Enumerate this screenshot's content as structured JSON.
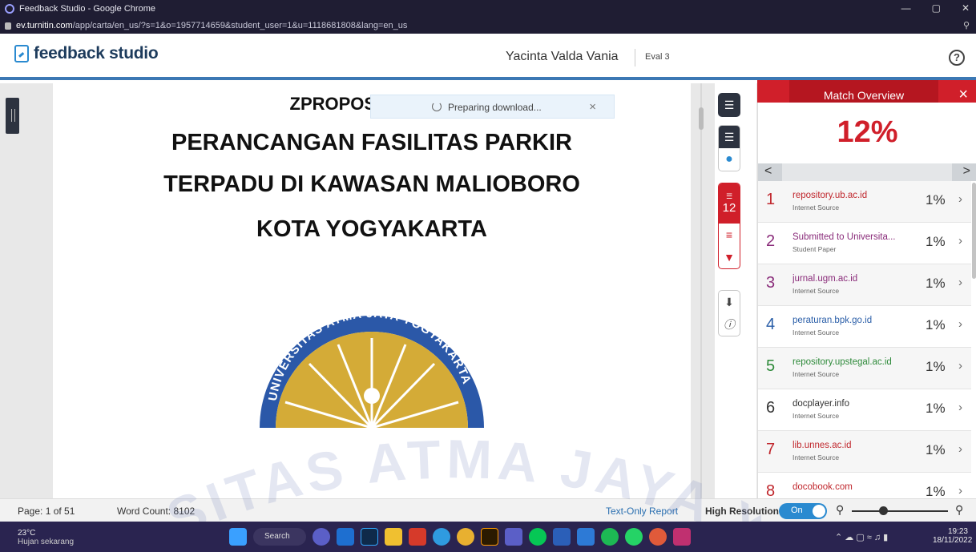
{
  "browser": {
    "window_title": "Feedback Studio - Google Chrome",
    "url_host": "ev.turnitin.com",
    "url_path": "/app/carta/en_us/?s=1&o=1957714659&student_user=1&u=1118681808&lang=en_us"
  },
  "header": {
    "logo_text": "feedback studio",
    "student_name": "Yacinta Valda Vania",
    "assignment": "Eval 3",
    "help_label": "?"
  },
  "toast": {
    "text": "Preparing download...",
    "close": "×"
  },
  "document": {
    "top_line": "ZPROPOSAL TUGA",
    "title_lines": [
      "PERANCANGAN FASILITAS PARKIR",
      "TERPADU DI KAWASAN MALIOBORO",
      "KOTA YOGYAKARTA"
    ],
    "logo_ring_text": "UNIVERSITAS ATMA JAYA YOGYAKARTA",
    "watermark_text": "SITAS ATMA JAYA YOGYA"
  },
  "tools": {
    "match_count": "12",
    "icons": [
      "layers-icon",
      "comment-icon",
      "match-icon",
      "sort-icon",
      "filter-icon",
      "download-icon",
      "info-icon"
    ]
  },
  "panel": {
    "title": "Match Overview",
    "close": "×",
    "similarity": "12%",
    "nav_prev": "<",
    "nav_next": ">",
    "matches": [
      {
        "num": "1",
        "source": "repository.ub.ac.id",
        "type": "Internet Source",
        "pct": "1%",
        "color": "#c0272d"
      },
      {
        "num": "2",
        "source": "Submitted to Universita...",
        "type": "Student Paper",
        "pct": "1%",
        "color": "#8a2c7a"
      },
      {
        "num": "3",
        "source": "jurnal.ugm.ac.id",
        "type": "Internet Source",
        "pct": "1%",
        "color": "#8a2c7a"
      },
      {
        "num": "4",
        "source": "peraturan.bpk.go.id",
        "type": "Internet Source",
        "pct": "1%",
        "color": "#2a5ea8"
      },
      {
        "num": "5",
        "source": "repository.upstegal.ac.id",
        "type": "Internet Source",
        "pct": "1%",
        "color": "#2e8a3a"
      },
      {
        "num": "6",
        "source": "docplayer.info",
        "type": "Internet Source",
        "pct": "1%",
        "color": "#333333"
      },
      {
        "num": "7",
        "source": "lib.unnes.ac.id",
        "type": "Internet Source",
        "pct": "1%",
        "color": "#c0272d"
      },
      {
        "num": "8",
        "source": "docobook.com",
        "type": "",
        "pct": "1%",
        "color": "#c0272d"
      }
    ]
  },
  "statusbar": {
    "page": "Page: 1 of 51",
    "word_count": "Word Count: 8102",
    "text_only": "Text-Only Report",
    "high_res": "High Resolution",
    "toggle": "On"
  },
  "taskbar": {
    "temp": "23°C",
    "weather": "Hujan sekarang",
    "search": "Search",
    "time": "19:23",
    "date": "18/11/2022"
  }
}
